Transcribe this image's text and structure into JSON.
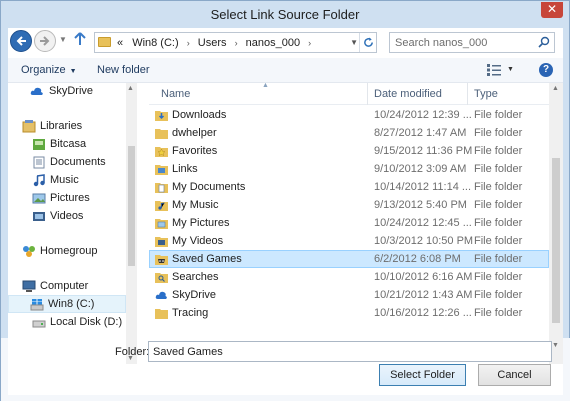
{
  "window": {
    "title": "Select Link Source Folder",
    "close_glyph": "✕"
  },
  "nav": {
    "back_icon": "back-arrow-icon",
    "forward_icon": "forward-arrow-icon",
    "up_icon": "up-arrow-icon"
  },
  "address": {
    "overflow": "«",
    "crumbs": [
      "Win8 (C:)",
      "Users",
      "nanos_000"
    ],
    "separator": "›"
  },
  "search": {
    "placeholder": "Search nanos_000"
  },
  "toolbar": {
    "organize_label": "Organize",
    "new_folder_label": "New folder",
    "help_glyph": "?"
  },
  "sidebar": {
    "items": [
      {
        "label": "SkyDrive",
        "icon": "cloud-icon"
      },
      {
        "label": "Libraries",
        "icon": "libraries-icon"
      },
      {
        "label": "Bitcasa",
        "icon": "bitcasa-icon"
      },
      {
        "label": "Documents",
        "icon": "documents-icon"
      },
      {
        "label": "Music",
        "icon": "music-icon"
      },
      {
        "label": "Pictures",
        "icon": "pictures-icon"
      },
      {
        "label": "Videos",
        "icon": "videos-icon"
      },
      {
        "label": "Homegroup",
        "icon": "homegroup-icon"
      },
      {
        "label": "Computer",
        "icon": "computer-icon"
      },
      {
        "label": "Win8 (C:)",
        "icon": "windows-drive-icon",
        "selected": true
      },
      {
        "label": "Local Disk (D:)",
        "icon": "drive-icon"
      }
    ]
  },
  "columns": {
    "name": "Name",
    "date": "Date modified",
    "type": "Type"
  },
  "files": [
    {
      "name": "Downloads",
      "date": "10/24/2012 12:39 ...",
      "type": "File folder",
      "icon": "downloads-folder-icon"
    },
    {
      "name": "dwhelper",
      "date": "8/27/2012 1:47 AM",
      "type": "File folder",
      "icon": "folder-icon"
    },
    {
      "name": "Favorites",
      "date": "9/15/2012 11:36 PM",
      "type": "File folder",
      "icon": "favorites-folder-icon"
    },
    {
      "name": "Links",
      "date": "9/10/2012 3:09 AM",
      "type": "File folder",
      "icon": "links-folder-icon"
    },
    {
      "name": "My Documents",
      "date": "10/14/2012 11:14 ...",
      "type": "File folder",
      "icon": "documents-folder-icon"
    },
    {
      "name": "My Music",
      "date": "9/13/2012 5:40 PM",
      "type": "File folder",
      "icon": "music-folder-icon"
    },
    {
      "name": "My Pictures",
      "date": "10/24/2012 12:45 ...",
      "type": "File folder",
      "icon": "pictures-folder-icon"
    },
    {
      "name": "My Videos",
      "date": "10/3/2012 10:50 PM",
      "type": "File folder",
      "icon": "videos-folder-icon"
    },
    {
      "name": "Saved Games",
      "date": "6/2/2012 6:08 PM",
      "type": "File folder",
      "icon": "saved-games-folder-icon",
      "selected": true
    },
    {
      "name": "Searches",
      "date": "10/10/2012 6:16 AM",
      "type": "File folder",
      "icon": "searches-folder-icon"
    },
    {
      "name": "SkyDrive",
      "date": "10/21/2012 1:43 AM",
      "type": "File folder",
      "icon": "skydrive-folder-icon"
    },
    {
      "name": "Tracing",
      "date": "10/16/2012 12:26 ...",
      "type": "File folder",
      "icon": "folder-icon"
    }
  ],
  "footer": {
    "folder_label": "Folder:",
    "folder_value": "Saved Games",
    "select_button": "Select Folder",
    "cancel_button": "Cancel"
  }
}
